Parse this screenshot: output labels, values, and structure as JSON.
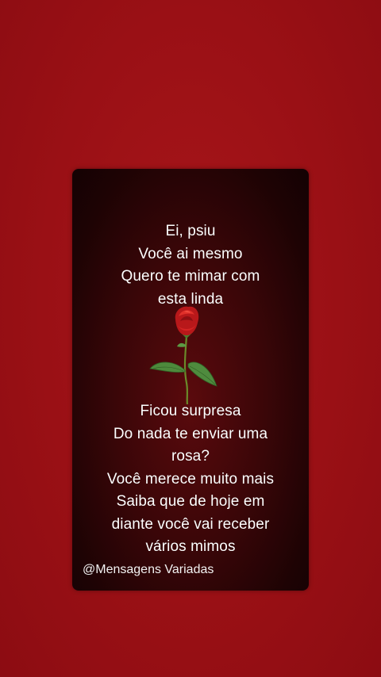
{
  "message_top": {
    "lines": [
      "Ei, psiu",
      "Você ai mesmo",
      "Quero te mimar com",
      "esta linda"
    ]
  },
  "message_bottom": {
    "lines": [
      "Ficou surpresa",
      "Do nada te enviar uma",
      "rosa?",
      "Você merece muito mais",
      "Saiba que de hoje em",
      "diante você vai receber",
      "vários mimos"
    ]
  },
  "image": {
    "icon": "rose-icon"
  },
  "watermark": {
    "handle": "@Mensagens Variadas"
  },
  "colors": {
    "background": "#9a1015",
    "card": "#2a0507",
    "text": "#ffffff",
    "rose_petal": "#c01a1a",
    "rose_leaf": "#4e8a3c"
  }
}
